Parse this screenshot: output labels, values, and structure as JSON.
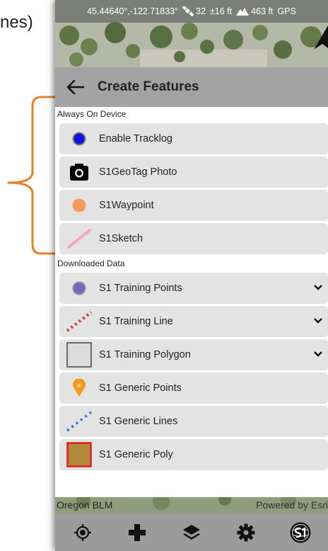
{
  "caption": {
    "text": "nes)"
  },
  "status_bar": {
    "coords": "45.44640°,-122.71833°",
    "satellites": "32",
    "accuracy": "±16 ft",
    "elevation": "463 ft",
    "source": "GPS"
  },
  "header": {
    "title": "Create Features"
  },
  "sections": [
    {
      "label": "Always On Device",
      "items": [
        {
          "label": "Enable Tracklog",
          "icon": "blue-dot-icon",
          "color": "#1010e0"
        },
        {
          "label": "S1GeoTag Photo",
          "icon": "camera-icon",
          "color": "#000000"
        },
        {
          "label": "S1Waypoint",
          "icon": "orange-dot-icon",
          "color": "#f59a5a"
        },
        {
          "label": "S1Sketch",
          "icon": "pink-line-icon",
          "color": "#f4a6bf"
        }
      ]
    },
    {
      "label": "Downloaded Data",
      "items": [
        {
          "label": "S1 Training Points",
          "icon": "purple-dot-icon",
          "color": "#6b6bc2",
          "dropdown": true
        },
        {
          "label": "S1 Training Line",
          "icon": "red-dashed-line-icon",
          "color": "#d83838",
          "dropdown": true
        },
        {
          "label": "S1 Training Polygon",
          "icon": "gray-square-icon",
          "color": "#444444",
          "dropdown": true
        },
        {
          "label": "S1 Generic Points",
          "icon": "orange-marker-icon",
          "color": "#f39a1e"
        },
        {
          "label": "S1 Generic Lines",
          "icon": "blue-dashed-line-icon",
          "color": "#2f6fe0"
        },
        {
          "label": "S1 Generic Poly",
          "icon": "brown-square-icon",
          "color": "#b08a3a",
          "stroke": "#e21b1b"
        }
      ]
    }
  ],
  "map_credits": {
    "left": "Oregon BLM",
    "right": "Powered by Esri"
  },
  "toolbar": [
    "location-icon",
    "add-icon",
    "layers-icon",
    "settings-icon",
    "s1-logo-icon"
  ]
}
